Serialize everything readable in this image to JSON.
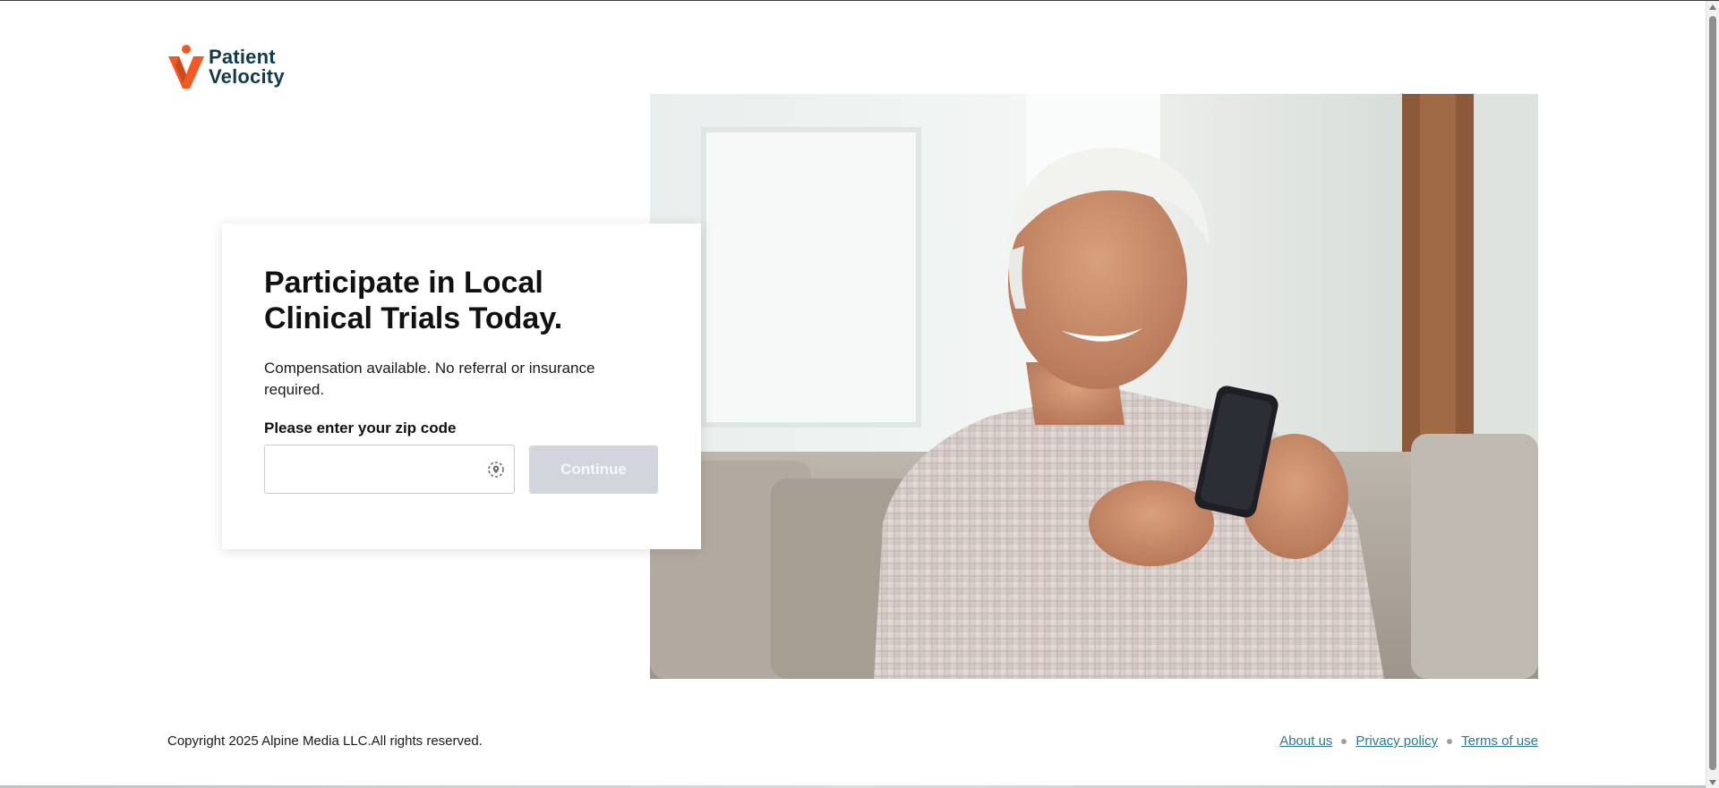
{
  "brand": {
    "name_line1": "Patient",
    "name_line2": "Velocity",
    "primary_color": "#f15a24",
    "text_color": "#0f3b4a"
  },
  "hero": {
    "icon": "hero-photo-elderly-man-with-phone"
  },
  "card": {
    "title": "Participate in Local Clinical Trials Today.",
    "subtitle": "Compensation available. No referral or insurance required.",
    "zip_label": "Please enter your zip code",
    "zip_value": "",
    "zip_placeholder": "",
    "locate_icon": "location-target-icon",
    "continue_label": "Continue",
    "continue_disabled": true
  },
  "footer": {
    "copyright": "Copyright 2025 Alpine Media LLC.All rights reserved.",
    "links": {
      "about": "About us",
      "privacy": "Privacy policy",
      "terms": "Terms of use"
    },
    "link_color": "#2b7a91"
  }
}
